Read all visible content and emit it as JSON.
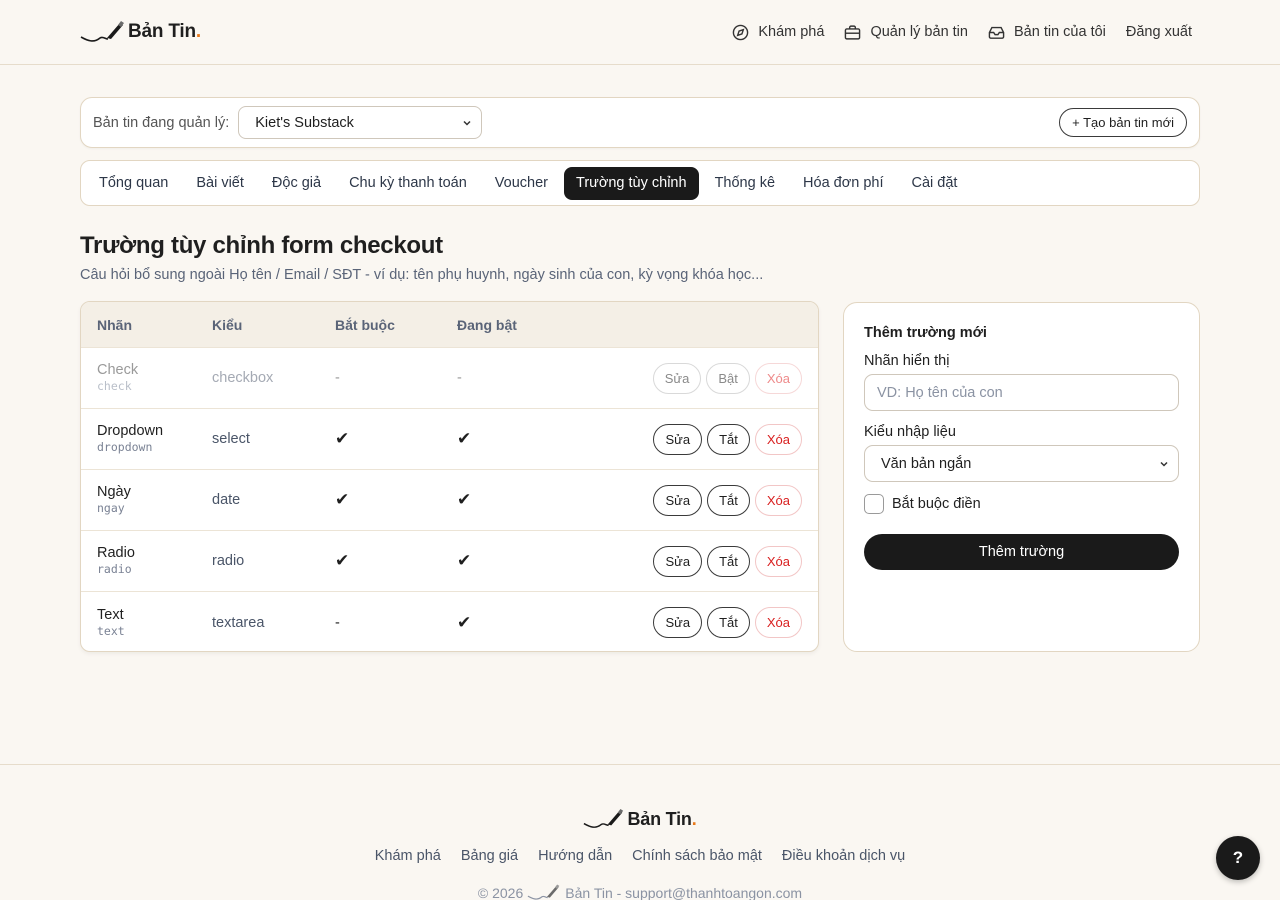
{
  "brand": {
    "name": "Bản Tin",
    "dot": "."
  },
  "nav": [
    {
      "label": "Khám phá",
      "icon": "compass-icon"
    },
    {
      "label": "Quản lý bản tin",
      "icon": "briefcase-icon"
    },
    {
      "label": "Bản tin của tôi",
      "icon": "inbox-icon"
    },
    {
      "label": "Đăng xuất"
    }
  ],
  "manage": {
    "label": "Bản tin đang quản lý:",
    "selected": "Kiet's Substack",
    "create_label": "+ Tạo bản tin mới"
  },
  "tabs": [
    {
      "label": "Tổng quan"
    },
    {
      "label": "Bài viết"
    },
    {
      "label": "Độc giả"
    },
    {
      "label": "Chu kỳ thanh toán"
    },
    {
      "label": "Voucher"
    },
    {
      "label": "Trường tùy chỉnh",
      "active": true
    },
    {
      "label": "Thống kê"
    },
    {
      "label": "Hóa đơn phí"
    },
    {
      "label": "Cài đặt"
    }
  ],
  "page": {
    "title": "Trường tùy chỉnh form checkout",
    "subtitle": "Câu hỏi bổ sung ngoài Họ tên / Email / SĐT - ví dụ: tên phụ huynh, ngày sinh của con, kỳ vọng khóa học..."
  },
  "table": {
    "headers": {
      "name": "Nhãn",
      "type": "Kiểu",
      "required": "Bắt buộc",
      "enabled": "Đang bật"
    },
    "rows": [
      {
        "name": "Check",
        "key": "check",
        "type": "checkbox",
        "required": "-",
        "enabled": "-",
        "edit": "Sửa",
        "toggle": "Bật",
        "delete": "Xóa",
        "disabled": true
      },
      {
        "name": "Dropdown",
        "key": "dropdown",
        "type": "select",
        "required": "✔",
        "enabled": "✔",
        "edit": "Sửa",
        "toggle": "Tắt",
        "delete": "Xóa"
      },
      {
        "name": "Ngày",
        "key": "ngay",
        "type": "date",
        "required": "✔",
        "enabled": "✔",
        "edit": "Sửa",
        "toggle": "Tắt",
        "delete": "Xóa"
      },
      {
        "name": "Radio",
        "key": "radio",
        "type": "radio",
        "required": "✔",
        "enabled": "✔",
        "edit": "Sửa",
        "toggle": "Tắt",
        "delete": "Xóa"
      },
      {
        "name": "Text",
        "key": "text",
        "type": "textarea",
        "required": "-",
        "enabled": "✔",
        "edit": "Sửa",
        "toggle": "Tắt",
        "delete": "Xóa"
      }
    ]
  },
  "add_form": {
    "title": "Thêm trường mới",
    "label_field": "Nhãn hiển thị",
    "label_placeholder": "VD: Họ tên của con",
    "type_field": "Kiểu nhập liệu",
    "type_selected": "Văn bản ngắn",
    "required_label": "Bắt buộc điền",
    "submit": "Thêm trường"
  },
  "footer": {
    "links": [
      "Khám phá",
      "Bảng giá",
      "Hướng dẫn",
      "Chính sách bảo mật",
      "Điều khoản dịch vụ"
    ],
    "copy_prefix": "© 2026",
    "copy_suffix": "Bản Tin - support@thanhtoangon.com"
  },
  "help": {
    "label": "?"
  }
}
